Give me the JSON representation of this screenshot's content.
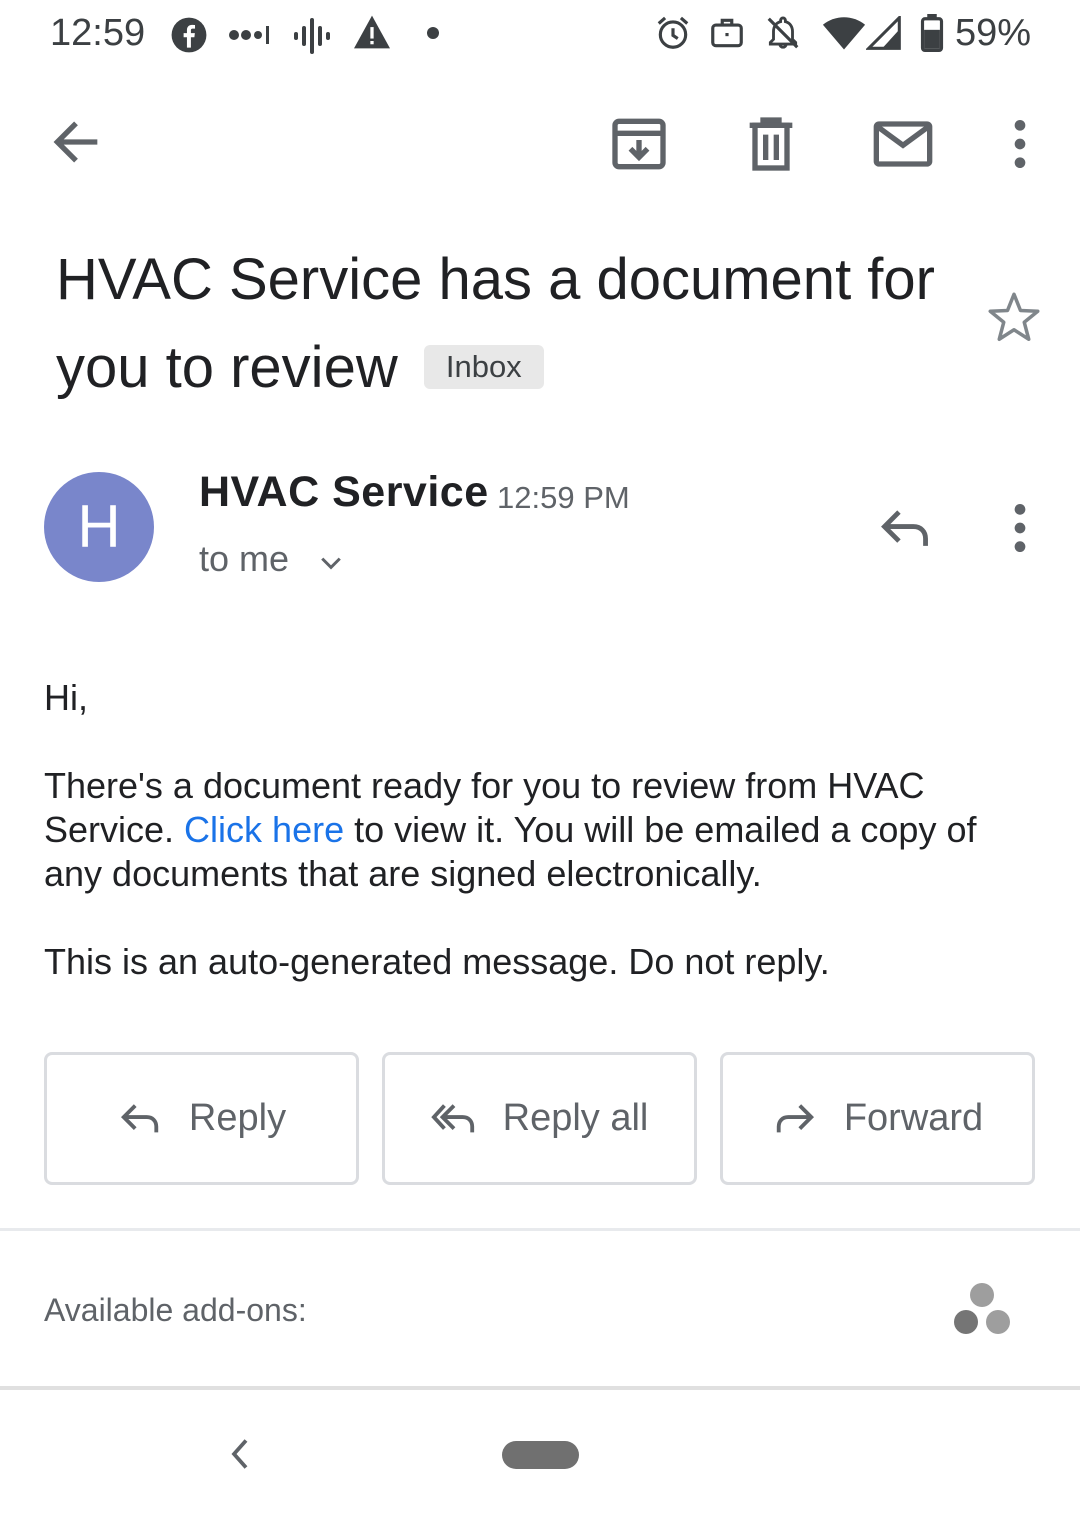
{
  "status_bar": {
    "time": "12:59",
    "battery": "59%",
    "left_icons": [
      "facebook-icon",
      "signal-dots-icon",
      "podcast-icon",
      "warning-icon",
      "dot-icon"
    ],
    "right_icons": [
      "alarm-icon",
      "work-icon",
      "notifications-off-icon",
      "wifi-icon",
      "cell-signal-icon",
      "battery-icon"
    ]
  },
  "toolbar": {
    "icons": [
      "back-arrow-icon",
      "archive-icon",
      "delete-icon",
      "mark-unread-icon",
      "more-vert-icon"
    ]
  },
  "email": {
    "subject": "HVAC Service has a document for you to review",
    "label": "Inbox",
    "starred": false,
    "sender": {
      "initial": "H",
      "name": "HVAC Service",
      "time": "12:59 PM",
      "recipient": "to me"
    },
    "body": {
      "greeting": "Hi,",
      "paragraph_before_link": "There's a document ready for you to review from HVAC Service. ",
      "link_text": "Click here",
      "paragraph_after_link": " to view it. You will be emailed a copy of any documents that are signed electronically.",
      "closing": "This is an auto-generated message. Do not reply."
    }
  },
  "actions": {
    "reply": "Reply",
    "reply_all": "Reply all",
    "forward": "Forward"
  },
  "addons": {
    "label": "Available add-ons:"
  },
  "colors": {
    "avatar": "#7986cb",
    "link": "#1a73e8",
    "icon": "#5f6368"
  }
}
